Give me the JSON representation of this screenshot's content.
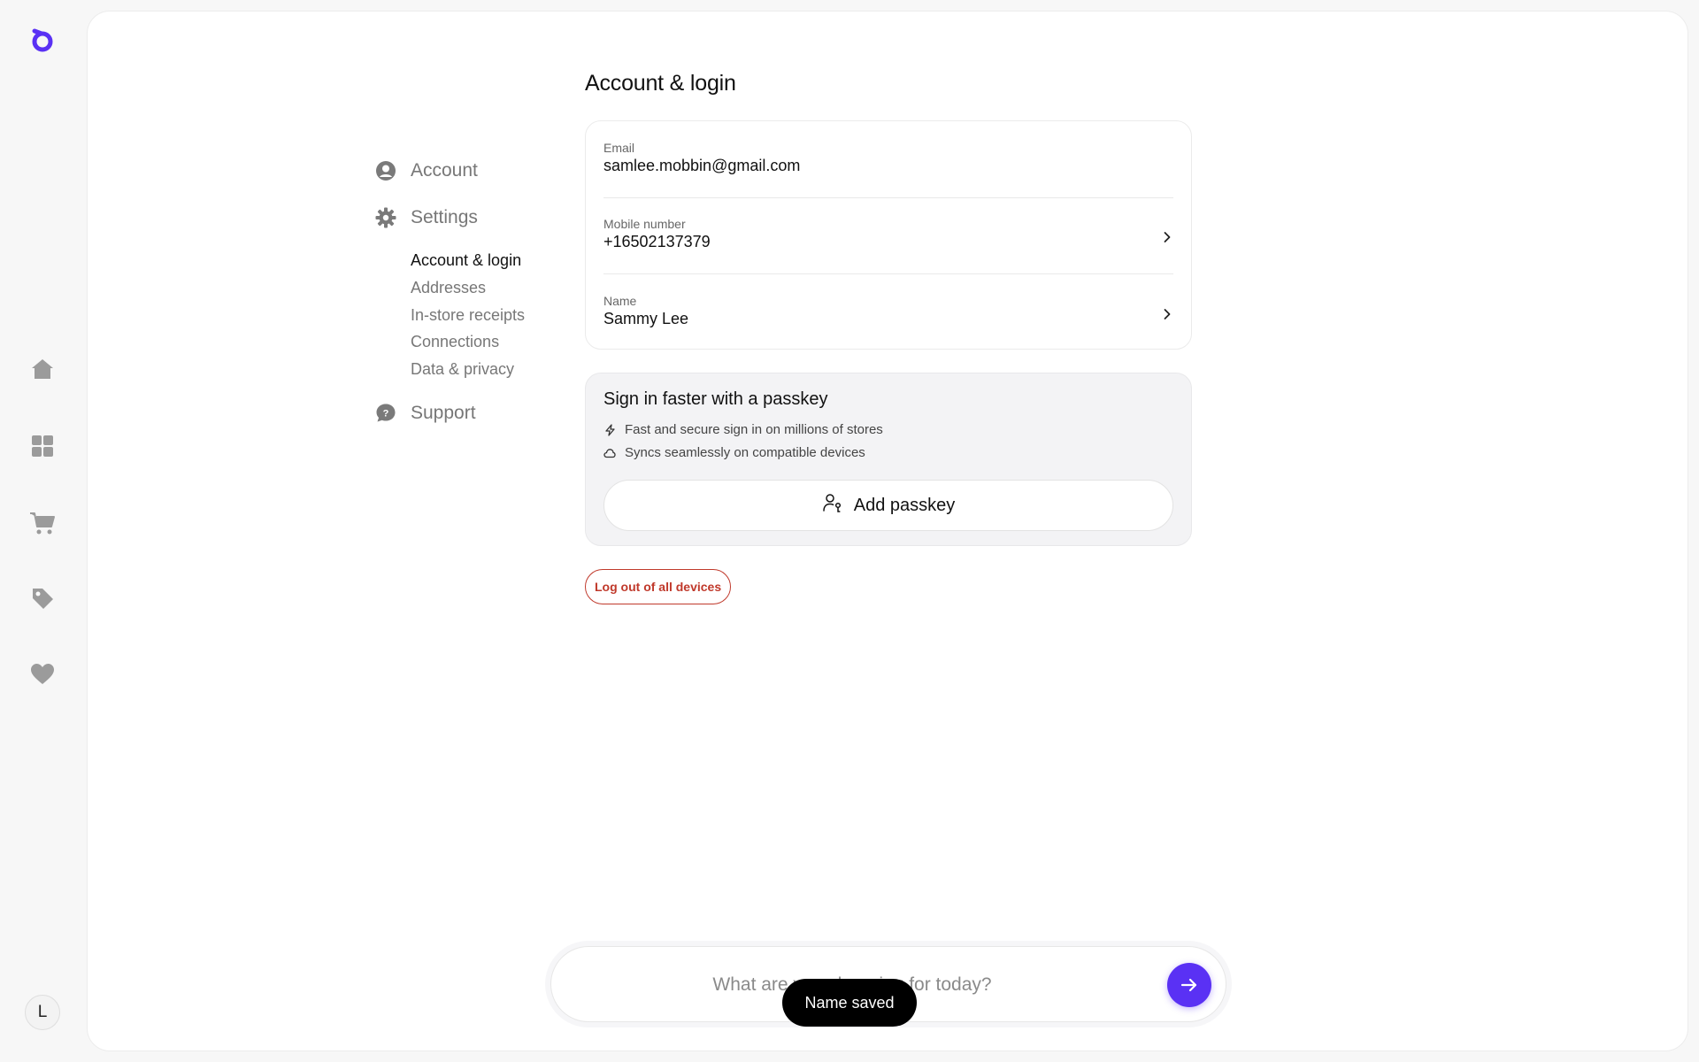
{
  "app": {
    "brand_color": "#5a31f4",
    "logo_icon": "shop-logo-icon"
  },
  "rail": {
    "items": [
      {
        "name": "home",
        "icon": "home-icon"
      },
      {
        "name": "apps",
        "icon": "grid-icon"
      },
      {
        "name": "cart",
        "icon": "cart-icon"
      },
      {
        "name": "offers",
        "icon": "tag-icon"
      },
      {
        "name": "favorites",
        "icon": "heart-icon"
      }
    ],
    "avatar_initial": "L"
  },
  "settings_nav": {
    "account": "Account",
    "settings": "Settings",
    "sub_items": [
      "Account & login",
      "Addresses",
      "In-store receipts",
      "Connections",
      "Data & privacy"
    ],
    "active_sub": "Account & login",
    "support": "Support"
  },
  "main": {
    "title": "Account & login",
    "fields": {
      "email": {
        "label": "Email",
        "value": "samlee.mobbin@gmail.com"
      },
      "mobile": {
        "label": "Mobile number",
        "value": "+16502137379"
      },
      "name": {
        "label": "Name",
        "value": "Sammy Lee"
      }
    },
    "passkey": {
      "title": "Sign in faster with a passkey",
      "feature_1": "Fast and secure sign in on millions of stores",
      "feature_2": "Syncs seamlessly on compatible devices",
      "button": "Add passkey"
    },
    "logout_label": "Log out of all devices",
    "logout_color": "#c0392b"
  },
  "prompt": {
    "placeholder": "What are you shopping for today?"
  },
  "toast": {
    "message": "Name saved"
  }
}
